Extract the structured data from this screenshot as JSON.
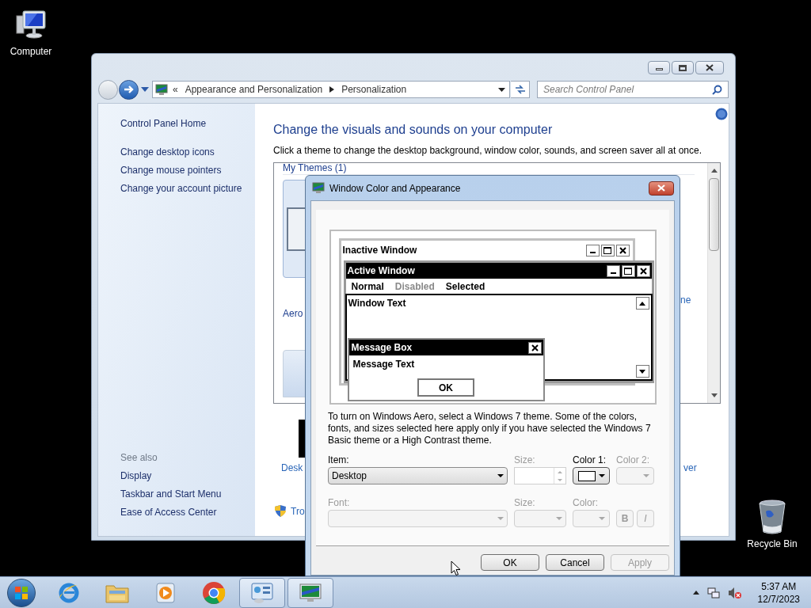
{
  "desktop_icons": [
    {
      "label": "Computer",
      "kind": "computer"
    },
    {
      "label": "Recycle Bin",
      "kind": "bin"
    }
  ],
  "control_panel": {
    "breadcrumb_prefix": "«",
    "breadcrumb": [
      "Appearance and Personalization",
      "Personalization"
    ],
    "search": {
      "placeholder": "Search Control Panel"
    },
    "sidebar": {
      "home": "Control Panel Home",
      "tasks": [
        "Change desktop icons",
        "Change mouse pointers",
        "Change your account picture"
      ],
      "see_also_title": "See also",
      "see_also": [
        "Display",
        "Taskbar and Start Menu",
        "Ease of Access Center"
      ]
    },
    "heading": "Change the visuals and sounds on your computer",
    "description": "Click a theme to change the desktop background, window color, sounds, and screen saver all at once.",
    "themes_group": "My Themes (1)",
    "theme_group_2": "Aero",
    "covered_fragments": [
      {
        "text": "ne",
        "kind": "theme-link"
      },
      {
        "text": "Desk",
        "kind": "bottom-link"
      },
      {
        "text": "ver",
        "kind": "right-link"
      },
      {
        "text": "Tro",
        "kind": "shield-link"
      }
    ]
  },
  "dialog": {
    "title": "Window Color and Appearance",
    "preview": {
      "inactive_title": "Inactive Window",
      "active_title": "Active Window",
      "menu": [
        {
          "label": "Normal",
          "kind": "normal"
        },
        {
          "label": "Disabled",
          "kind": "disabled"
        },
        {
          "label": "Selected",
          "kind": "selected"
        }
      ],
      "window_text": "Window Text",
      "message_box_title": "Message Box",
      "message_text": "Message Text",
      "ok": "OK"
    },
    "note": "To turn on Windows Aero, select a Windows 7 theme.  Some of the colors, fonts, and sizes selected here apply only if you have selected the Windows 7 Basic theme or a High Contrast theme.",
    "fields": [
      {
        "label": "Item:",
        "kind": "select",
        "value": "Desktop",
        "disabled": false
      },
      {
        "label": "Size:",
        "kind": "spin",
        "disabled": true
      },
      {
        "label": "Color 1:",
        "kind": "color",
        "disabled": false
      },
      {
        "label": "Color 2:",
        "kind": "color",
        "disabled": true
      },
      {
        "label": "Font:",
        "kind": "select",
        "disabled": true
      },
      {
        "label": "Size:",
        "kind": "select",
        "disabled": true
      },
      {
        "label": "Color:",
        "kind": "color",
        "disabled": true
      },
      {
        "kind": "style",
        "buttons": [
          "B",
          "I"
        ],
        "disabled": true
      }
    ],
    "buttons": [
      {
        "label": "OK",
        "disabled": false
      },
      {
        "label": "Cancel",
        "disabled": false
      },
      {
        "label": "Apply",
        "disabled": true
      }
    ]
  },
  "taskbar": {
    "apps": [
      {
        "kind": "ie",
        "active": false
      },
      {
        "kind": "explorer",
        "active": false
      },
      {
        "kind": "media",
        "active": false
      },
      {
        "kind": "chrome",
        "active": false
      },
      {
        "kind": "control-panel",
        "active": true
      },
      {
        "kind": "personalization",
        "active": true
      }
    ],
    "time": "5:37 AM",
    "date": "12/7/2023"
  }
}
